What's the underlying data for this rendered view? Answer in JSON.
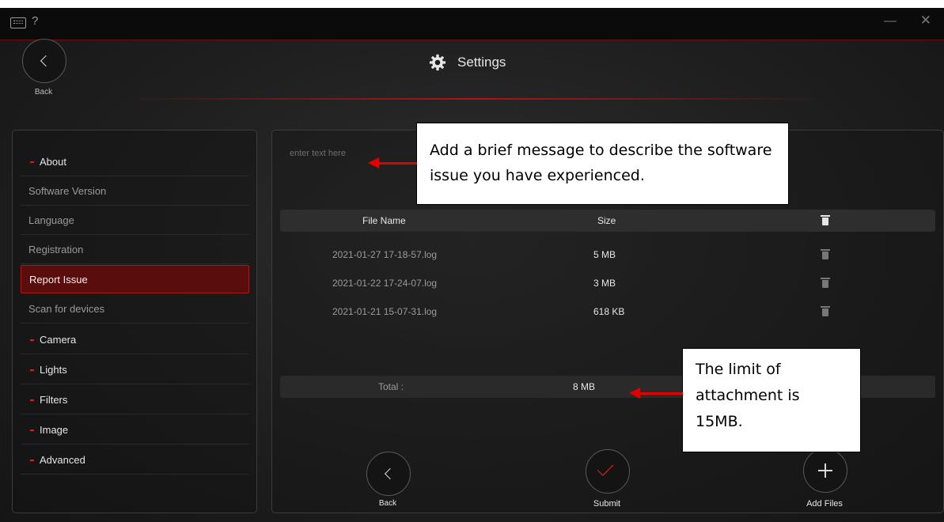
{
  "titlebar": {
    "help": "?",
    "minimize": "—",
    "close": "✕"
  },
  "header": {
    "back_label": "Back",
    "title": "Settings"
  },
  "sidebar": {
    "items": [
      {
        "label": "About",
        "type": "section"
      },
      {
        "label": "Software Version",
        "type": "item"
      },
      {
        "label": "Language",
        "type": "item"
      },
      {
        "label": "Registration",
        "type": "item"
      },
      {
        "label": "Report Issue",
        "type": "active"
      },
      {
        "label": "Scan for devices",
        "type": "item"
      },
      {
        "label": "Camera",
        "type": "section"
      },
      {
        "label": "Lights",
        "type": "section"
      },
      {
        "label": "Filters",
        "type": "section"
      },
      {
        "label": "Image",
        "type": "section"
      },
      {
        "label": "Advanced",
        "type": "section"
      }
    ]
  },
  "report": {
    "message_placeholder": "enter text here",
    "table": {
      "col_name": "File Name",
      "col_size": "Size",
      "rows": [
        {
          "name": "2021-01-27 17-18-57.log",
          "size": "5 MB"
        },
        {
          "name": "2021-01-22 17-24-07.log",
          "size": "3 MB"
        },
        {
          "name": "2021-01-21 15-07-31.log",
          "size": "618 KB"
        }
      ]
    },
    "total_label": "Total :",
    "total_value": "8 MB",
    "buttons": {
      "back": "Back",
      "submit": "Submit",
      "add_files": "Add Files"
    }
  },
  "callouts": {
    "message": "Add a brief message to describe the software issue you have experienced.",
    "limit": "The limit of attachment is 15MB."
  },
  "colors": {
    "accent": "#d41f1f",
    "active_bg": "#5a0d0d",
    "arrow": "#e00000"
  }
}
